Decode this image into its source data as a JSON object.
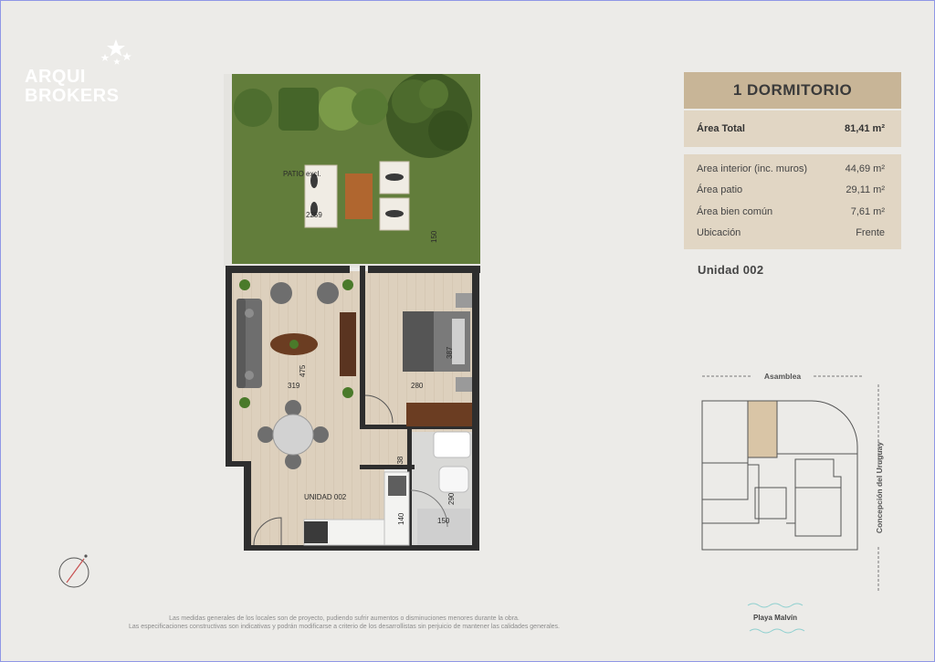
{
  "brand": {
    "line1": "ARQUI",
    "line2": "BROKERS"
  },
  "unit_card": {
    "title": "1 DORMITORIO",
    "total": {
      "label": "Área Total",
      "value": "81,41 m²"
    },
    "details": [
      {
        "label": "Area interior (inc. muros)",
        "value": "44,69 m²"
      },
      {
        "label": "Área patio",
        "value": "29,11 m²"
      },
      {
        "label": "Área bien común",
        "value": "7,61 m²"
      },
      {
        "label": "Ubicación",
        "value": "Frente"
      }
    ],
    "unit_label": "Unidad  002"
  },
  "floor_plan": {
    "patio_label": "PATIO excl.",
    "unit_label": "UNIDAD 002",
    "dimensions": [
      "2259",
      "150",
      "475",
      "319",
      "280",
      "387",
      "138",
      "290",
      "140",
      "150"
    ]
  },
  "key_plan": {
    "top_street": "Asamblea",
    "side_street": "Concepción del Uruguay",
    "bottom_label": "Playa Malvín"
  },
  "disclaimer": {
    "line1": "Las medidas generales de los locales son de proyecto, pudiendo sufrir aumentos o disminuciones menores durante la obra.",
    "line2": "Las especificaciones constructivas son indicativas y podrán modificarse a criterio de los desarrollistas sin perjuicio de mantener las calidades generales."
  },
  "colors": {
    "accent": "#c8b597",
    "card_bg": "#e1d6c4",
    "highlight": "#d9c5a6",
    "grass": "#5f7a3a",
    "wood_floor": "#ddd0bd",
    "wall": "#2e2e2e",
    "water": "#8fd0cf"
  },
  "icons": [
    "stars-icon",
    "compass-icon",
    "tree-icon",
    "sofa-icon",
    "bed-icon",
    "plant-icon",
    "wave-icon"
  ]
}
